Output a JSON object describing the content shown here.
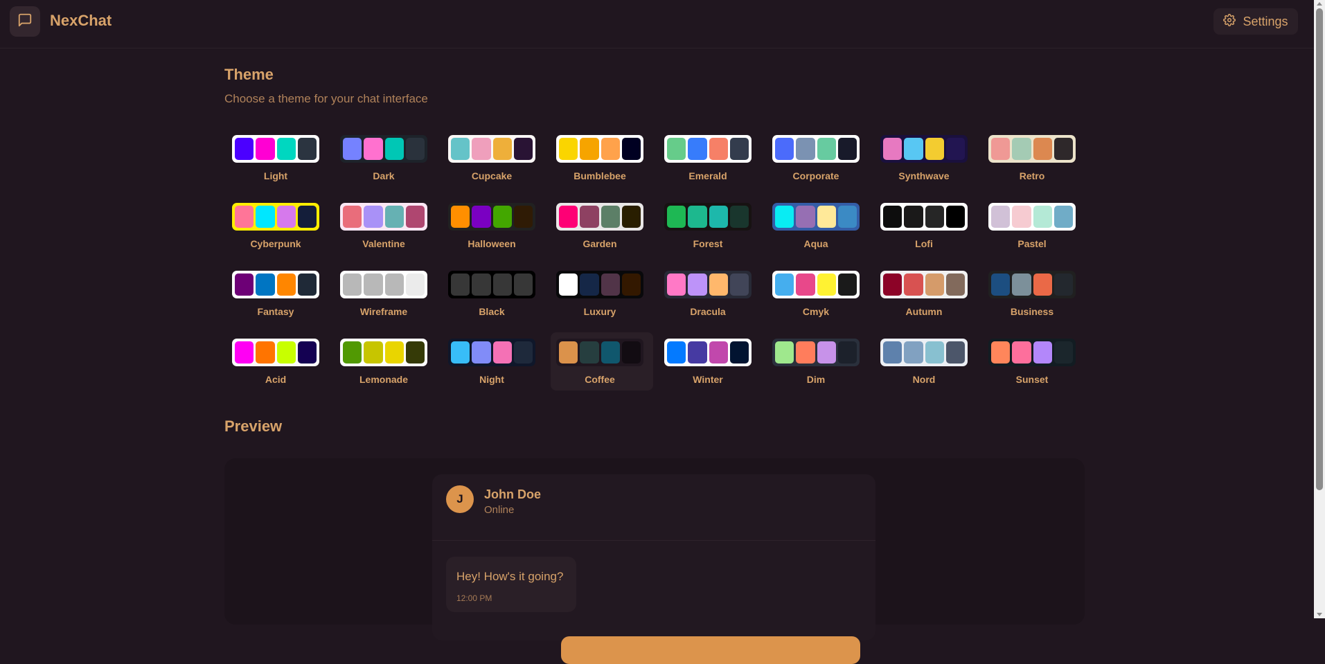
{
  "app": {
    "title": "NexChat",
    "logo_icon": "chat-bubble-icon"
  },
  "header": {
    "settings_label": "Settings",
    "settings_icon": "gear-icon"
  },
  "theme_section": {
    "title": "Theme",
    "subtitle": "Choose a theme for your chat interface",
    "selected": "Coffee",
    "themes": [
      {
        "name": "Light",
        "frame": "#ffffff",
        "colors": [
          "#4b00ff",
          "#ff00d3",
          "#00d7c0",
          "#2b3440"
        ]
      },
      {
        "name": "Dark",
        "frame": "#1d232a",
        "colors": [
          "#7582ff",
          "#ff71cf",
          "#00c7b5",
          "#2a323c"
        ]
      },
      {
        "name": "Cupcake",
        "frame": "#faf7f5",
        "colors": [
          "#65c3c8",
          "#ef9fbc",
          "#eeaf3a",
          "#291334"
        ]
      },
      {
        "name": "Bumblebee",
        "frame": "#ffffff",
        "colors": [
          "#fad500",
          "#f6a400",
          "#ffa24b",
          "#000022"
        ]
      },
      {
        "name": "Emerald",
        "frame": "#ffffff",
        "colors": [
          "#66cc8a",
          "#377cfb",
          "#f68067",
          "#333c4d"
        ]
      },
      {
        "name": "Corporate",
        "frame": "#ffffff",
        "colors": [
          "#4b6bfb",
          "#7b92b2",
          "#67cba0",
          "#181a2a"
        ]
      },
      {
        "name": "Synthwave",
        "frame": "#1a103d",
        "colors": [
          "#e779c1",
          "#58c7f3",
          "#f3cc30",
          "#221551"
        ]
      },
      {
        "name": "Retro",
        "frame": "#ece3ca",
        "colors": [
          "#ef9995",
          "#a4cbb4",
          "#dc8850",
          "#2e282a"
        ]
      },
      {
        "name": "Cyberpunk",
        "frame": "#ffee00",
        "colors": [
          "#ff7598",
          "#00e7ff",
          "#d679ec",
          "#141e3a"
        ]
      },
      {
        "name": "Valentine",
        "frame": "#fae7f4",
        "colors": [
          "#e96d7b",
          "#a991f7",
          "#66b1b3",
          "#af4670"
        ]
      },
      {
        "name": "Halloween",
        "frame": "#212121",
        "colors": [
          "#ff8f00",
          "#7a00c2",
          "#43a700",
          "#2f1b05"
        ]
      },
      {
        "name": "Garden",
        "frame": "#e9e7e7",
        "colors": [
          "#fe0075",
          "#8e4162",
          "#5c7f67",
          "#291e00"
        ]
      },
      {
        "name": "Forest",
        "frame": "#171212",
        "colors": [
          "#1eb854",
          "#1db88e",
          "#1db8ab",
          "#19362d"
        ]
      },
      {
        "name": "Aqua",
        "frame": "#345da7",
        "colors": [
          "#09ecf3",
          "#966fb3",
          "#ffe999",
          "#3b8ac4"
        ]
      },
      {
        "name": "Lofi",
        "frame": "#ffffff",
        "colors": [
          "#0d0d0d",
          "#1a1919",
          "#262626",
          "#000000"
        ]
      },
      {
        "name": "Pastel",
        "frame": "#ffffff",
        "colors": [
          "#d1c1d7",
          "#f6cbd1",
          "#b4e9d6",
          "#70acc7"
        ]
      },
      {
        "name": "Fantasy",
        "frame": "#ffffff",
        "colors": [
          "#6d0076",
          "#0075c2",
          "#ff8600",
          "#1f2937"
        ]
      },
      {
        "name": "Wireframe",
        "frame": "#ffffff",
        "colors": [
          "#b8b8b8",
          "#b8b8b8",
          "#b8b8b8",
          "#ebebeb"
        ]
      },
      {
        "name": "Black",
        "frame": "#000000",
        "colors": [
          "#373737",
          "#373737",
          "#373737",
          "#373737"
        ]
      },
      {
        "name": "Luxury",
        "frame": "#09090b",
        "colors": [
          "#ffffff",
          "#152747",
          "#513448",
          "#331800"
        ]
      },
      {
        "name": "Dracula",
        "frame": "#282a36",
        "colors": [
          "#ff79c6",
          "#bd93f9",
          "#ffb86c",
          "#414558"
        ]
      },
      {
        "name": "Cmyk",
        "frame": "#ffffff",
        "colors": [
          "#45aeee",
          "#e8488a",
          "#fff232",
          "#1a1a1a"
        ]
      },
      {
        "name": "Autumn",
        "frame": "#f1f1f1",
        "colors": [
          "#8c0327",
          "#d85251",
          "#d59b6a",
          "#826a5c"
        ]
      },
      {
        "name": "Business",
        "frame": "#202020",
        "colors": [
          "#1c4e80",
          "#7c909a",
          "#ea6947",
          "#23282e"
        ]
      },
      {
        "name": "Acid",
        "frame": "#fafafa",
        "colors": [
          "#ff00f4",
          "#ff7400",
          "#c8ff00",
          "#140152"
        ]
      },
      {
        "name": "Lemonade",
        "frame": "#ffffff",
        "colors": [
          "#519903",
          "#c7c500",
          "#e9d500",
          "#353a07"
        ]
      },
      {
        "name": "Night",
        "frame": "#0f172a",
        "colors": [
          "#38bdf8",
          "#818cf8",
          "#f471b5",
          "#1e293b"
        ]
      },
      {
        "name": "Coffee",
        "frame": "#20161f",
        "colors": [
          "#db924b",
          "#263e3f",
          "#10576d",
          "#120c12"
        ]
      },
      {
        "name": "Winter",
        "frame": "#ffffff",
        "colors": [
          "#047aff",
          "#463aa2",
          "#c148ac",
          "#021431"
        ]
      },
      {
        "name": "Dim",
        "frame": "#2a303c",
        "colors": [
          "#9fe88d",
          "#ff7d5c",
          "#c792e9",
          "#1c212b"
        ]
      },
      {
        "name": "Nord",
        "frame": "#eceff4",
        "colors": [
          "#5e81ac",
          "#81a1c1",
          "#88c0d0",
          "#4c566a"
        ]
      },
      {
        "name": "Sunset",
        "frame": "#121c22",
        "colors": [
          "#ff865b",
          "#fd6f9c",
          "#b387fa",
          "#1b262c"
        ]
      }
    ]
  },
  "preview": {
    "title": "Preview",
    "contact": {
      "name": "John Doe",
      "status": "Online",
      "initial": "J"
    },
    "messages": [
      {
        "text": "Hey! How's it going?",
        "time": "12:00 PM"
      }
    ]
  }
}
